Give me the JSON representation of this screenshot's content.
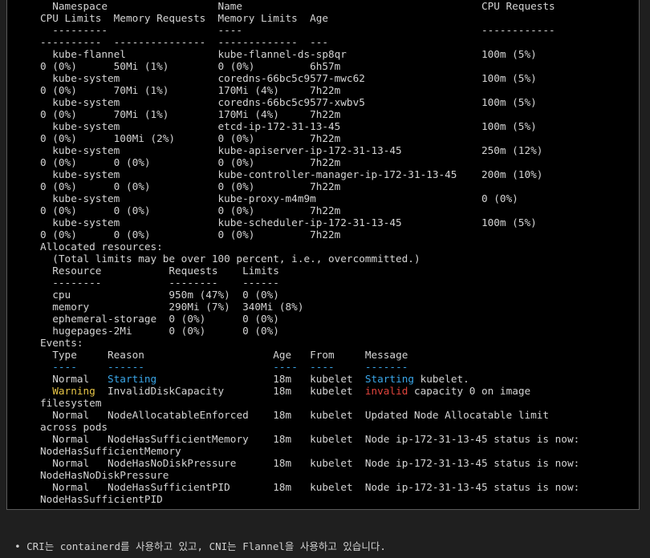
{
  "terminal": {
    "lines": [
      "  Namespace                  Name                                       CPU Requests",
      "CPU Limits  Memory Requests  Memory Limits  Age",
      "  ---------                  ----                                       ------------",
      "----------  ---------------  -------------  ---",
      "  kube-flannel               kube-flannel-ds-sp8qr                      100m (5%)",
      "0 (0%)      50Mi (1%)        0 (0%)         6h57m",
      "  kube-system                coredns-66bc5c9577-mwc62                   100m (5%)",
      "0 (0%)      70Mi (1%)        170Mi (4%)     7h22m",
      "  kube-system                coredns-66bc5c9577-xwbv5                   100m (5%)",
      "0 (0%)      70Mi (1%)        170Mi (4%)     7h22m",
      "  kube-system                etcd-ip-172-31-13-45                       100m (5%)",
      "0 (0%)      100Mi (2%)       0 (0%)         7h22m",
      "  kube-system                kube-apiserver-ip-172-31-13-45             250m (12%)",
      "0 (0%)      0 (0%)           0 (0%)         7h22m",
      "  kube-system                kube-controller-manager-ip-172-31-13-45    200m (10%)",
      "0 (0%)      0 (0%)           0 (0%)         7h22m",
      "  kube-system                kube-proxy-m4m9m                           0 (0%)",
      "0 (0%)      0 (0%)           0 (0%)         7h22m",
      "  kube-system                kube-scheduler-ip-172-31-13-45             100m (5%)",
      "0 (0%)      0 (0%)           0 (0%)         7h22m",
      "Allocated resources:",
      "  (Total limits may be over 100 percent, i.e., overcommitted.)",
      "  Resource           Requests    Limits",
      "  --------           --------    ------",
      "  cpu                950m (47%)  0 (0%)",
      "  memory             290Mi (7%)  340Mi (8%)",
      "  ephemeral-storage  0 (0%)      0 (0%)",
      "  hugepages-2Mi      0 (0%)      0 (0%)",
      "Events:"
    ],
    "events_header": {
      "cols": [
        "Type",
        "Reason",
        "Age",
        "From",
        "Message"
      ],
      "dashes": [
        "----",
        "------",
        "----",
        "----",
        "-------"
      ]
    },
    "events": [
      {
        "type": "Normal",
        "reason": "Starting",
        "age": "18m",
        "from": "kubelet",
        "msg_hl": "Starting",
        "msg_rest": " kubelet.",
        "wrap": ""
      },
      {
        "type": "Warning",
        "reason": "InvalidDiskCapacity",
        "age": "18m",
        "from": "kubelet",
        "msg_hl": "invalid",
        "msg_rest": " capacity 0 on image",
        "wrap": "filesystem"
      },
      {
        "type": "Normal",
        "reason": "NodeAllocatableEnforced",
        "age": "18m",
        "from": "kubelet",
        "msg_hl": "",
        "msg_rest": "Updated Node Allocatable limit",
        "wrap": "across pods"
      },
      {
        "type": "Normal",
        "reason": "NodeHasSufficientMemory",
        "age": "18m",
        "from": "kubelet",
        "msg_hl": "",
        "msg_rest": "Node ip-172-31-13-45 status is now:",
        "wrap": "NodeHasSufficientMemory"
      },
      {
        "type": "Normal",
        "reason": "NodeHasNoDiskPressure",
        "age": "18m",
        "from": "kubelet",
        "msg_hl": "",
        "msg_rest": "Node ip-172-31-13-45 status is now:",
        "wrap": "NodeHasNoDiskPressure"
      },
      {
        "type": "Normal",
        "reason": "NodeHasSufficientPID",
        "age": "18m",
        "from": "kubelet",
        "msg_hl": "",
        "msg_rest": "Node ip-172-31-13-45 status is now:",
        "wrap": "NodeHasSufficientPID"
      }
    ],
    "colors": {
      "background": "#000000",
      "text": "#d4d4d4",
      "highlight_cyan": "#3aa6e8",
      "warning_yellow": "#e7c547",
      "error_red": "#e0443c"
    }
  },
  "footer": {
    "bullet": "•",
    "text": "CRI는 containerd를 사용하고 있고, CNI는 Flannel을 사용하고 있습니다."
  }
}
